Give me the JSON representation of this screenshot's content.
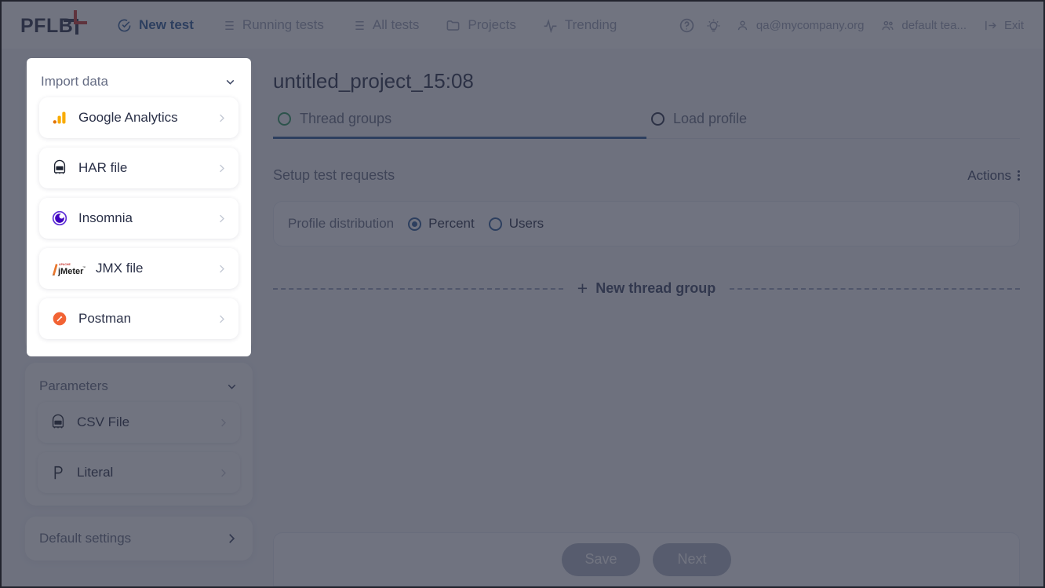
{
  "header": {
    "logo_text": "PFLB",
    "nav": [
      {
        "label": "New test",
        "icon": "check-circle-icon",
        "active": true
      },
      {
        "label": "Running tests",
        "icon": "list-icon",
        "active": false
      },
      {
        "label": "All tests",
        "icon": "list-icon",
        "active": false
      },
      {
        "label": "Projects",
        "icon": "folder-icon",
        "active": false
      },
      {
        "label": "Trending",
        "icon": "pulse-icon",
        "active": false
      }
    ],
    "help_icon": "question-circle-icon",
    "theme_icon": "lightbulb-icon",
    "account": {
      "label": "qa@mycompany.org",
      "icon": "user-icon"
    },
    "team": {
      "label": "default tea...",
      "icon": "users-icon"
    },
    "exit": {
      "label": "Exit",
      "icon": "exit-icon"
    }
  },
  "sidebar": {
    "import": {
      "title": "Import data",
      "chevron_icon": "chevron-down-icon",
      "items": [
        {
          "label": "Google Analytics",
          "icon": "google-analytics-icon",
          "chevron": "chevron-right-icon"
        },
        {
          "label": "HAR file",
          "icon": "har-file-icon",
          "chevron": "chevron-right-icon"
        },
        {
          "label": "Insomnia",
          "icon": "insomnia-icon",
          "chevron": "chevron-right-icon"
        },
        {
          "label": "JMX file",
          "icon": "jmeter-icon",
          "chevron": "chevron-right-icon"
        },
        {
          "label": "Postman",
          "icon": "postman-icon",
          "chevron": "chevron-right-icon"
        }
      ]
    },
    "parameters": {
      "title": "Parameters",
      "chevron_icon": "chevron-down-icon",
      "items": [
        {
          "label": "CSV File",
          "icon": "csv-file-icon",
          "chevron": "chevron-right-icon"
        },
        {
          "label": "Literal",
          "icon": "literal-p-icon",
          "chevron": "chevron-right-icon"
        }
      ]
    },
    "default_settings": {
      "label": "Default settings",
      "chevron_icon": "chevron-right-icon"
    }
  },
  "main": {
    "page_title": "untitled_project_15:08",
    "tabs": [
      {
        "label": "Thread groups",
        "active": true,
        "marker_color": "#2d9a5f"
      },
      {
        "label": "Load profile",
        "active": false,
        "marker_color": "#2b3148"
      }
    ],
    "section_title": "Setup test requests",
    "actions_label": "Actions",
    "actions_icon": "kebab-menu-icon",
    "profile_distribution": {
      "label": "Profile distribution",
      "options": [
        {
          "label": "Percent",
          "selected": true
        },
        {
          "label": "Users",
          "selected": false
        }
      ]
    },
    "new_thread_group": {
      "label": "New thread group",
      "icon": "plus-icon"
    },
    "footer_buttons": [
      {
        "label": "Save"
      },
      {
        "label": "Next"
      }
    ]
  },
  "colors": {
    "accent": "#2e5c9a",
    "green": "#2d9a5f",
    "overlay": "#565a6b",
    "logo_red": "#c8352f",
    "text_dark": "#2b3148",
    "text_muted": "#666d84"
  }
}
